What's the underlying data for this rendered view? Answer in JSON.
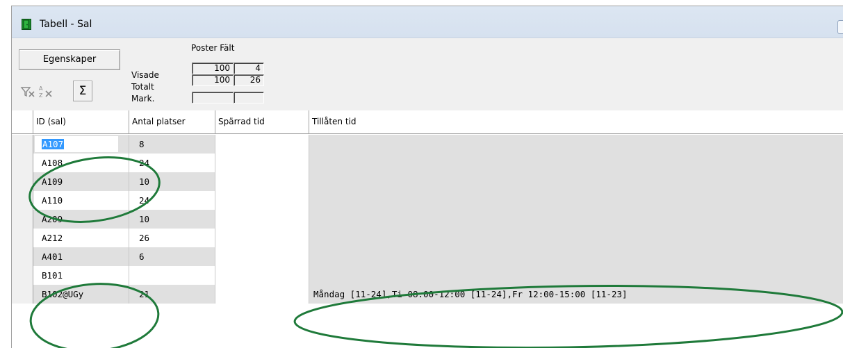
{
  "window": {
    "title": "Tabell - Sal"
  },
  "toolbar": {
    "properties_label": "Egenskaper",
    "icons": [
      "clear-filter-icon",
      "sort-icon",
      "sum-icon"
    ],
    "sum_glyph": "Σ"
  },
  "stats": {
    "header": "Poster Fält",
    "rows": [
      {
        "label": "Visade",
        "poster": "100",
        "falt": "4"
      },
      {
        "label": "Totalt",
        "poster": "100",
        "falt": "26"
      },
      {
        "label": "Mark.",
        "poster": "",
        "falt": ""
      }
    ]
  },
  "table": {
    "columns": [
      "ID (sal)",
      "Antal platser",
      "Spärrad tid",
      "Tillåten tid"
    ],
    "rows": [
      {
        "id": "A107",
        "seats": "8",
        "blocked": "",
        "allowed": ""
      },
      {
        "id": "A108",
        "seats": "24",
        "blocked": "",
        "allowed": ""
      },
      {
        "id": "A109",
        "seats": "10",
        "blocked": "",
        "allowed": ""
      },
      {
        "id": "A110",
        "seats": "24",
        "blocked": "",
        "allowed": ""
      },
      {
        "id": "A209",
        "seats": "10",
        "blocked": "",
        "allowed": ""
      },
      {
        "id": "A212",
        "seats": "26",
        "blocked": "",
        "allowed": ""
      },
      {
        "id": "A401",
        "seats": "6",
        "blocked": "",
        "allowed": ""
      },
      {
        "id": "B101",
        "seats": "",
        "blocked": "",
        "allowed": ""
      },
      {
        "id": "B102@UGy",
        "seats": "21",
        "blocked": "",
        "allowed": "Måndag [11-24],Ti 08:00-12:00 [11-24],Fr 12:00-15:00 [11-23]"
      }
    ]
  },
  "colors": {
    "annotation": "#1f7a3a",
    "selection": "#3399ff",
    "titlebar": "#dce6f2"
  }
}
